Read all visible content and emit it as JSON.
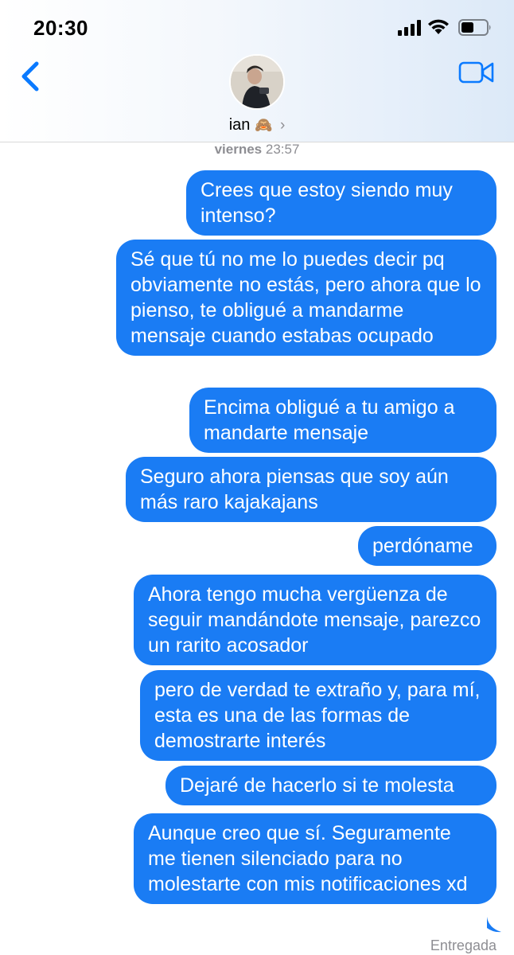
{
  "status_bar": {
    "time": "20:30"
  },
  "header": {
    "contact_name": "ian",
    "contact_emoji": "🙈",
    "chevron": "›"
  },
  "conversation": {
    "timestamp_day": "viernes",
    "timestamp_time": "23:57",
    "messages": [
      "Crees que estoy siendo muy intenso?",
      "Sé que tú no me lo puedes decir pq obviamente no estás, pero ahora que lo pienso, te obligué a mandarme mensaje cuando estabas ocupado",
      "Encima obligué a tu amigo a mandarte mensaje",
      "Seguro ahora piensas que soy aún más raro kajakajans",
      "perdóname",
      "Ahora tengo mucha vergüenza de seguir mandándote mensaje, parezco un rarito acosador",
      "pero de verdad te extraño y, para mí, esta es una de las formas de demostrarte interés",
      "Dejaré de hacerlo si te molesta",
      "Aunque creo que sí. Seguramente me tienen silenciado para no molestarte con mis notificaciones xd"
    ],
    "delivery_status": "Entregada"
  },
  "colors": {
    "bubble_blue": "#1a7cf4",
    "ios_blue": "#0a7aff",
    "timestamp_gray": "#8e8e93"
  },
  "icons": [
    "signal-icon",
    "wifi-icon",
    "battery-icon",
    "back-chevron-icon",
    "video-call-icon"
  ]
}
